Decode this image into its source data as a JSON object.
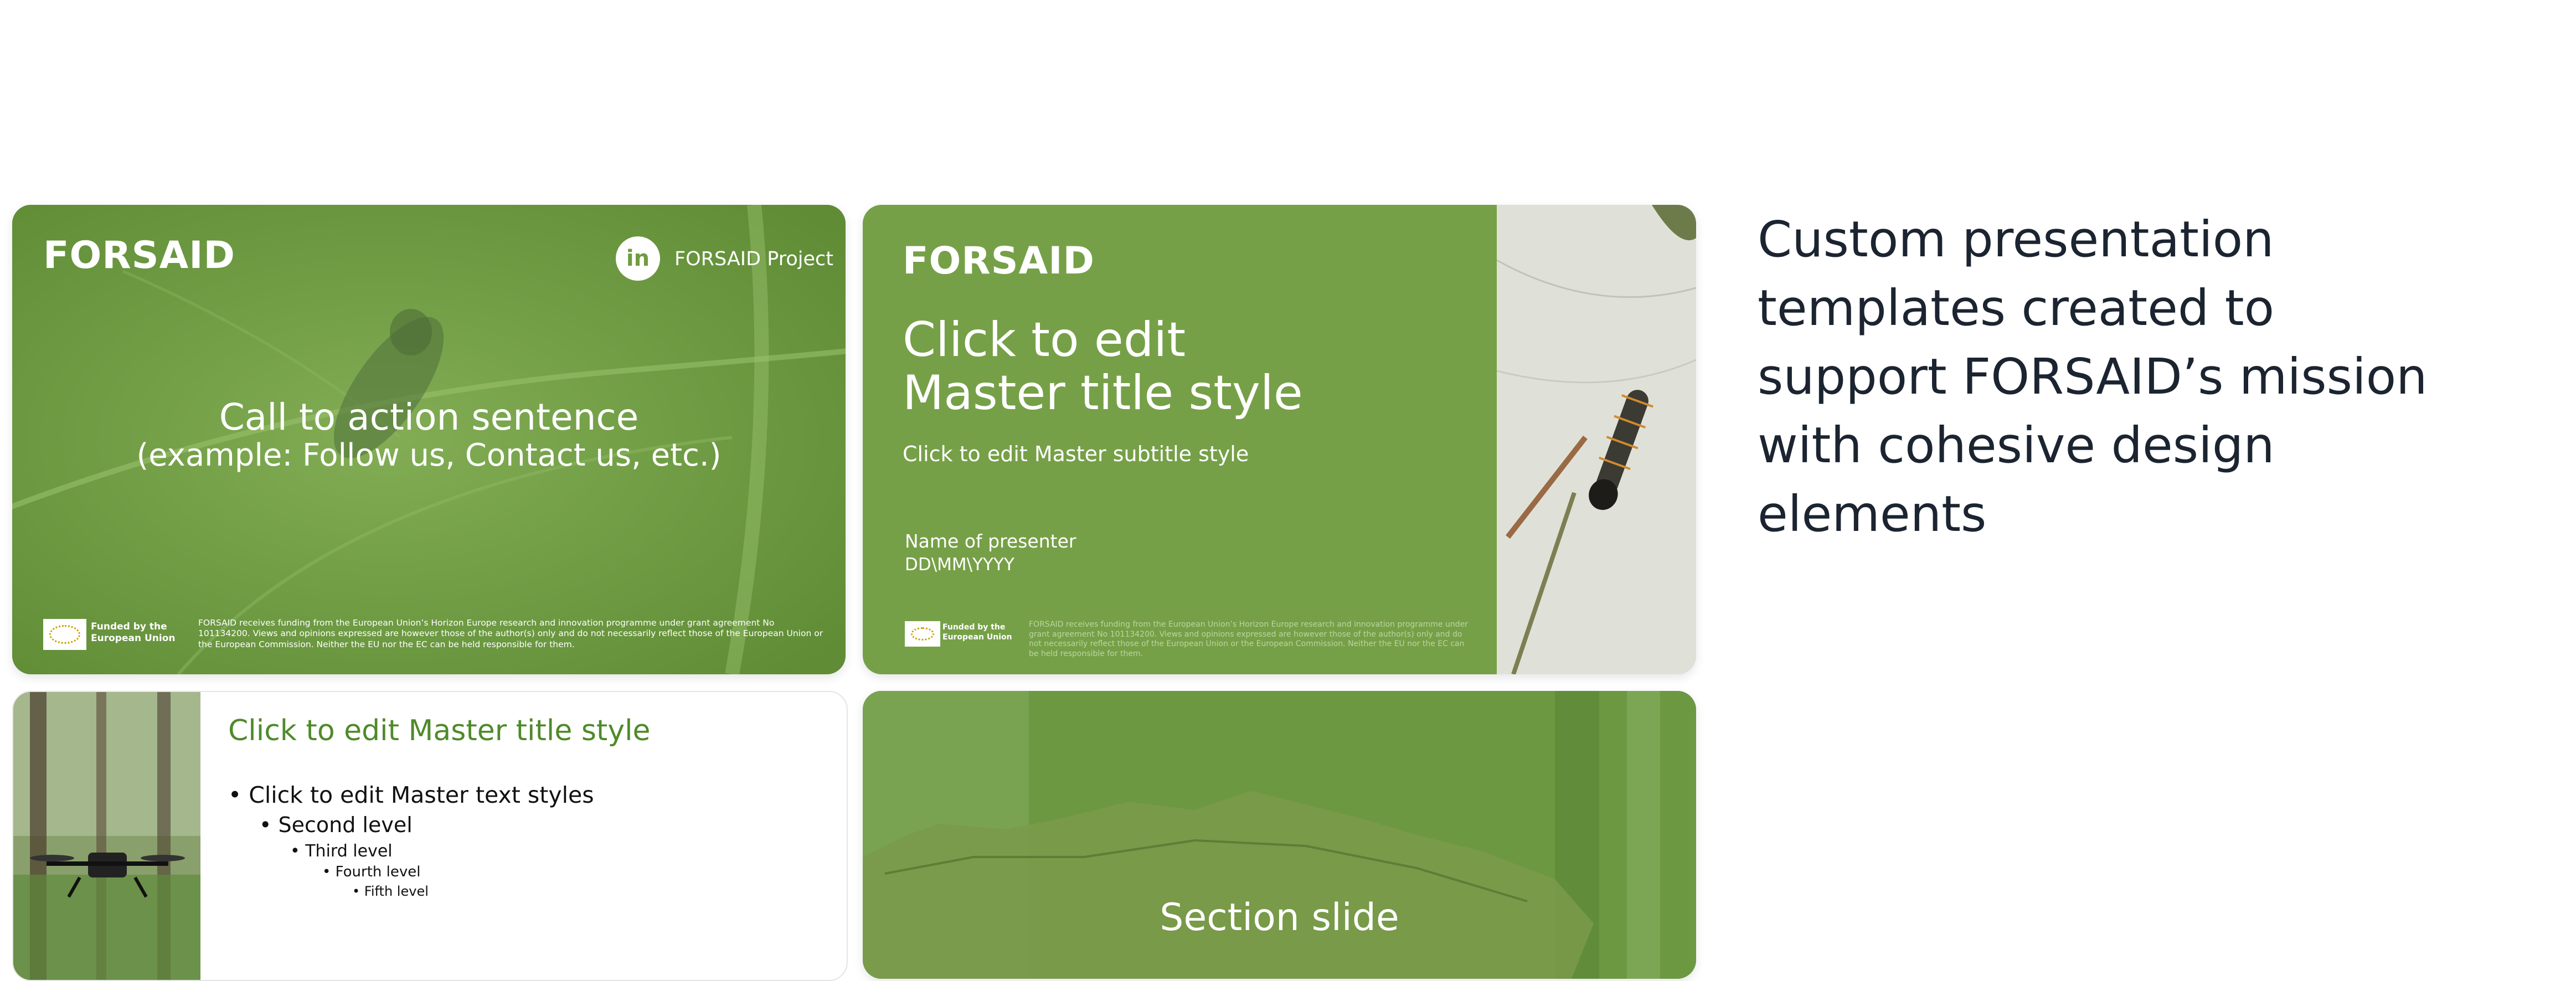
{
  "brand": {
    "logo_text": "FORSAID"
  },
  "slide_cta": {
    "social_label": "FORSAID Project",
    "social_icon": "linkedin-icon",
    "line1": "Call to action sentence",
    "line2": "(example: Follow us, Contact us, etc.)",
    "funded": "Funded by the European Union",
    "disclaimer": "FORSAID receives funding from the European Union’s Horizon Europe research and innovation programme under grant agreement No 101134200. Views and opinions expressed are however those of the author(s) only and do not necessarily reflect those of the European Union or the European Commission. Neither the EU nor the EC can be held responsible for them."
  },
  "slide_title": {
    "title": "Click to edit Master title style",
    "subtitle": "Click to edit Master subtitle style",
    "presenter": "Name of presenter",
    "date": "DD\\MM\\YYYY",
    "funded": "Funded by the European Union",
    "disclaimer": "FORSAID receives funding from the European Union’s Horizon Europe research and innovation programme under grant agreement No 101134200. Views and opinions expressed are however those of the author(s) only and do not necessarily reflect those of the European Union or the European Commission. Neither the EU nor the EC can be held responsible for them."
  },
  "slide_content": {
    "title": "Click to edit Master title style",
    "levels": [
      "Click to edit Master text styles",
      "Second level",
      "Third level",
      "Fourth level",
      "Fifth level"
    ]
  },
  "slide_section": {
    "title": "Section slide"
  },
  "description": "Custom presentation templates created to support FORSAID’s mission with cohesive design elements",
  "colors": {
    "brand_green": "#76a047",
    "title_green": "#4f8a2a",
    "text_dark": "#1b2430"
  }
}
